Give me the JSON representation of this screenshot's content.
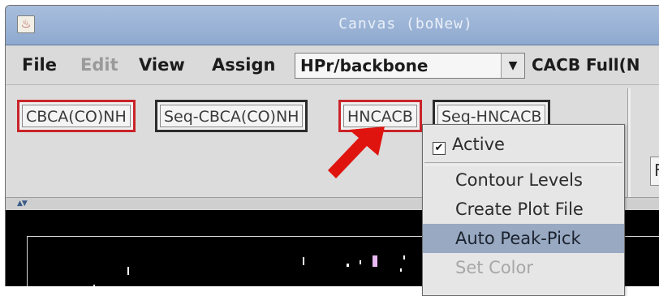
{
  "window": {
    "title": "Canvas  (boNew)"
  },
  "menubar": {
    "items": [
      {
        "label": "File",
        "enabled": true
      },
      {
        "label": "Edit",
        "enabled": false
      },
      {
        "label": "View",
        "enabled": true
      },
      {
        "label": "Assign",
        "enabled": true
      }
    ],
    "combo_value": "HPr/backbone",
    "right_label": "CACB Full(N"
  },
  "toolbar": {
    "spectra": [
      {
        "label": "CBCA(CO)NH",
        "highlight": "red"
      },
      {
        "label": "Seq-CBCA(CO)NH",
        "highlight": "black"
      },
      {
        "label": "HNCACB",
        "highlight": "red"
      },
      {
        "label": "Seq-HNCACB",
        "highlight": "black"
      }
    ],
    "right_field": "F"
  },
  "context_menu": {
    "active_label": "Active",
    "active_checked": true,
    "items": [
      {
        "label": "Contour Levels",
        "state": "normal"
      },
      {
        "label": "Create Plot File",
        "state": "normal"
      },
      {
        "label": "Auto Peak-Pick",
        "state": "highlighted"
      },
      {
        "label": "Set Color",
        "state": "disabled"
      }
    ]
  },
  "annotation": {
    "arrow_color": "#e0140f"
  },
  "colors": {
    "titlebar": "#98b1d5",
    "highlight_red": "#c9242a",
    "menu_highlight": "#98a9c1"
  }
}
